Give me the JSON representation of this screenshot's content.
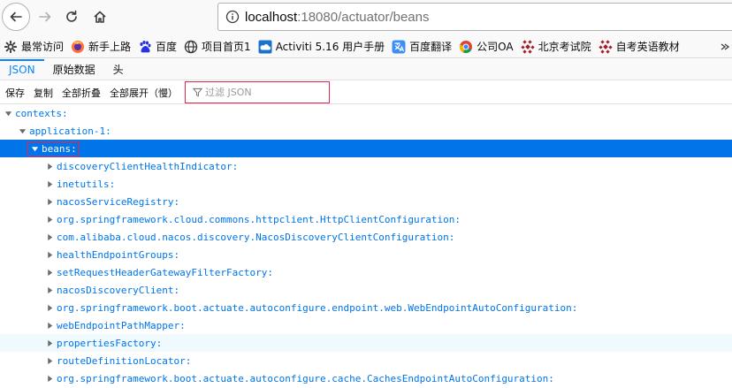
{
  "browser": {
    "url_host": "localhost",
    "url_rest": ":18080/actuator/beans"
  },
  "bookmarks": [
    {
      "label": "最常访问",
      "icon": "gear-icon"
    },
    {
      "label": "新手上路",
      "icon": "firefox-icon"
    },
    {
      "label": "百度",
      "icon": "baidu-paw-icon"
    },
    {
      "label": "项目首页1",
      "icon": "globe-icon"
    },
    {
      "label": "Activiti 5.16 用户手册",
      "icon": "cloud-icon"
    },
    {
      "label": "百度翻译",
      "icon": "translate-icon"
    },
    {
      "label": "公司OA",
      "icon": "chrome-icon"
    },
    {
      "label": "北京考试院",
      "icon": "exam-icon"
    },
    {
      "label": "自考英语教材",
      "icon": "exam-icon"
    }
  ],
  "viewer_tabs": [
    {
      "label": "JSON",
      "active": true
    },
    {
      "label": "原始数据",
      "active": false
    },
    {
      "label": "头",
      "active": false
    }
  ],
  "toolbar": {
    "save": "保存",
    "copy": "复制",
    "collapse_all": "全部折叠",
    "expand_all": "全部展开（慢）",
    "filter_placeholder": "过滤 JSON",
    "filter_value": ""
  },
  "tree": {
    "contexts": "contexts:",
    "application": "application-1:",
    "beans": "beans:",
    "bean_keys": [
      "discoveryClientHealthIndicator:",
      "inetutils:",
      "nacosServiceRegistry:",
      "org.springframework.cloud.commons.httpclient.HttpClientConfiguration:",
      "com.alibaba.cloud.nacos.discovery.NacosDiscoveryClientConfiguration:",
      "healthEndpointGroups:",
      "setRequestHeaderGatewayFilterFactory:",
      "nacosDiscoveryClient:",
      "org.springframework.boot.actuate.autoconfigure.endpoint.web.WebEndpointAutoConfiguration:",
      "webEndpointPathMapper:",
      "propertiesFactory:",
      "routeDefinitionLocator:",
      "org.springframework.boot.actuate.autoconfigure.cache.CachesEndpointAutoConfiguration:"
    ]
  }
}
